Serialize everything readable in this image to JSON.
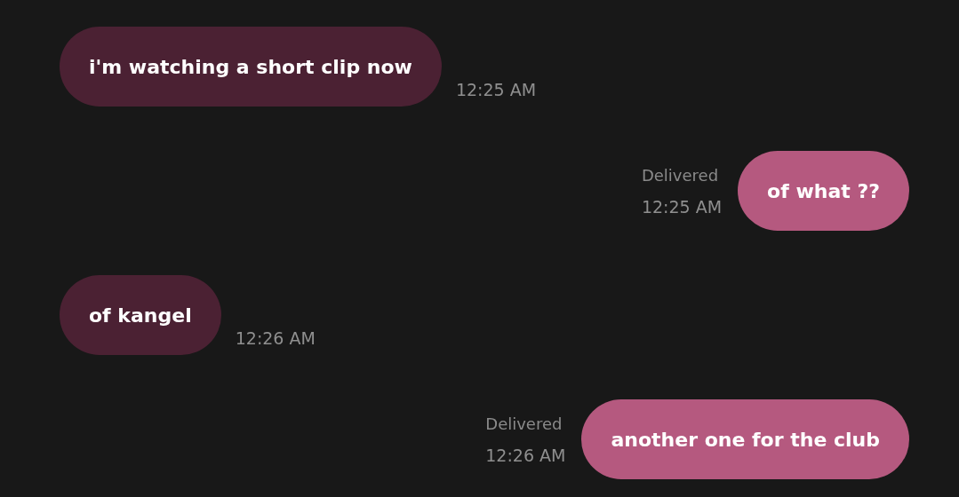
{
  "messages": [
    {
      "kind": "incoming",
      "text": "i'm watching a short clip now",
      "time": "12:25 AM"
    },
    {
      "kind": "outgoing",
      "text": "of what ??",
      "status": "Delivered",
      "time": "12:25 AM"
    },
    {
      "kind": "incoming",
      "text": "of kangel",
      "time": "12:26 AM"
    },
    {
      "kind": "outgoing",
      "text": "another one for the club",
      "status": "Delivered",
      "time": "12:26 AM"
    }
  ]
}
